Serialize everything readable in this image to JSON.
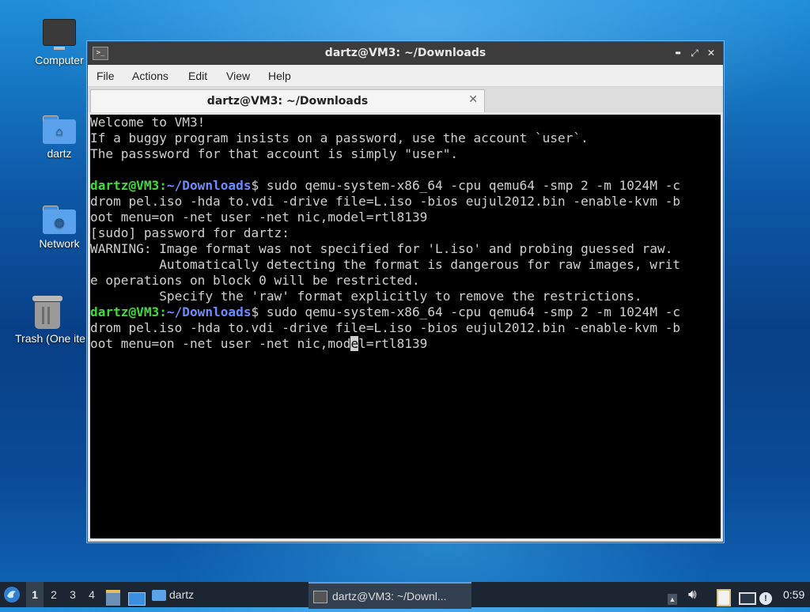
{
  "desktop": {
    "icons": [
      {
        "label": "Computer",
        "icon": "computer-icon"
      },
      {
        "label": "dartz",
        "icon": "home-folder-icon"
      },
      {
        "label": "Network",
        "icon": "network-folder-icon"
      },
      {
        "label": "Trash (One ite",
        "icon": "trash-icon"
      }
    ]
  },
  "window": {
    "title": "dartz@VM3: ~/Downloads",
    "controls": {
      "minimize": "▬",
      "maximize": "⤢",
      "close": "✕"
    },
    "menu": [
      "File",
      "Actions",
      "Edit",
      "View",
      "Help"
    ],
    "tab": {
      "label": "dartz@VM3: ~/Downloads",
      "close": "✕"
    }
  },
  "terminal": {
    "prompt_user": "dartz@VM3",
    "prompt_path": "~/Downloads",
    "lines": {
      "l1": "Welcome to VM3!",
      "l2": "If a buggy program insists on a password, use the account `user`.",
      "l3": "The passsword for that account is simply \"user\".",
      "c1_1": "$ sudo qemu-system-x86_64 -cpu qemu64 -smp 2 -m 1024M -c",
      "c1_2": "drom pel.iso -hda to.vdi -drive file=L.iso -bios eujul2012.bin -enable-kvm -b",
      "c1_3": "oot menu=on -net user -net nic,model=rtl8139",
      "l8": "[sudo] password for dartz:",
      "l9": "WARNING: Image format was not specified for 'L.iso' and probing guessed raw.",
      "l10": "         Automatically detecting the format is dangerous for raw images, writ",
      "l11": "e operations on block 0 will be restricted.",
      "l12": "         Specify the 'raw' format explicitly to remove the restrictions.",
      "c2_1": "$ sudo qemu-system-x86_64 -cpu qemu64 -smp 2 -m 1024M -c",
      "c2_2": "drom pel.iso -hda to.vdi -drive file=L.iso -bios eujul2012.bin -enable-kvm -b",
      "c2_3a": "oot menu=on -net user -net nic,mod",
      "c2_3cursor": "e",
      "c2_3b": "l=rtl8139"
    }
  },
  "taskbar": {
    "workspaces": [
      "1",
      "2",
      "3",
      "4"
    ],
    "active_workspace": "1",
    "folder_button": "dartz",
    "task_button": "dartz@VM3: ~/Downl...",
    "clock": "0:59"
  },
  "colors": {
    "prompt_user": "#3edc3e",
    "prompt_path": "#6a8cff",
    "taskbar": "#1c2633",
    "titlebar": "#3c3c3c"
  }
}
